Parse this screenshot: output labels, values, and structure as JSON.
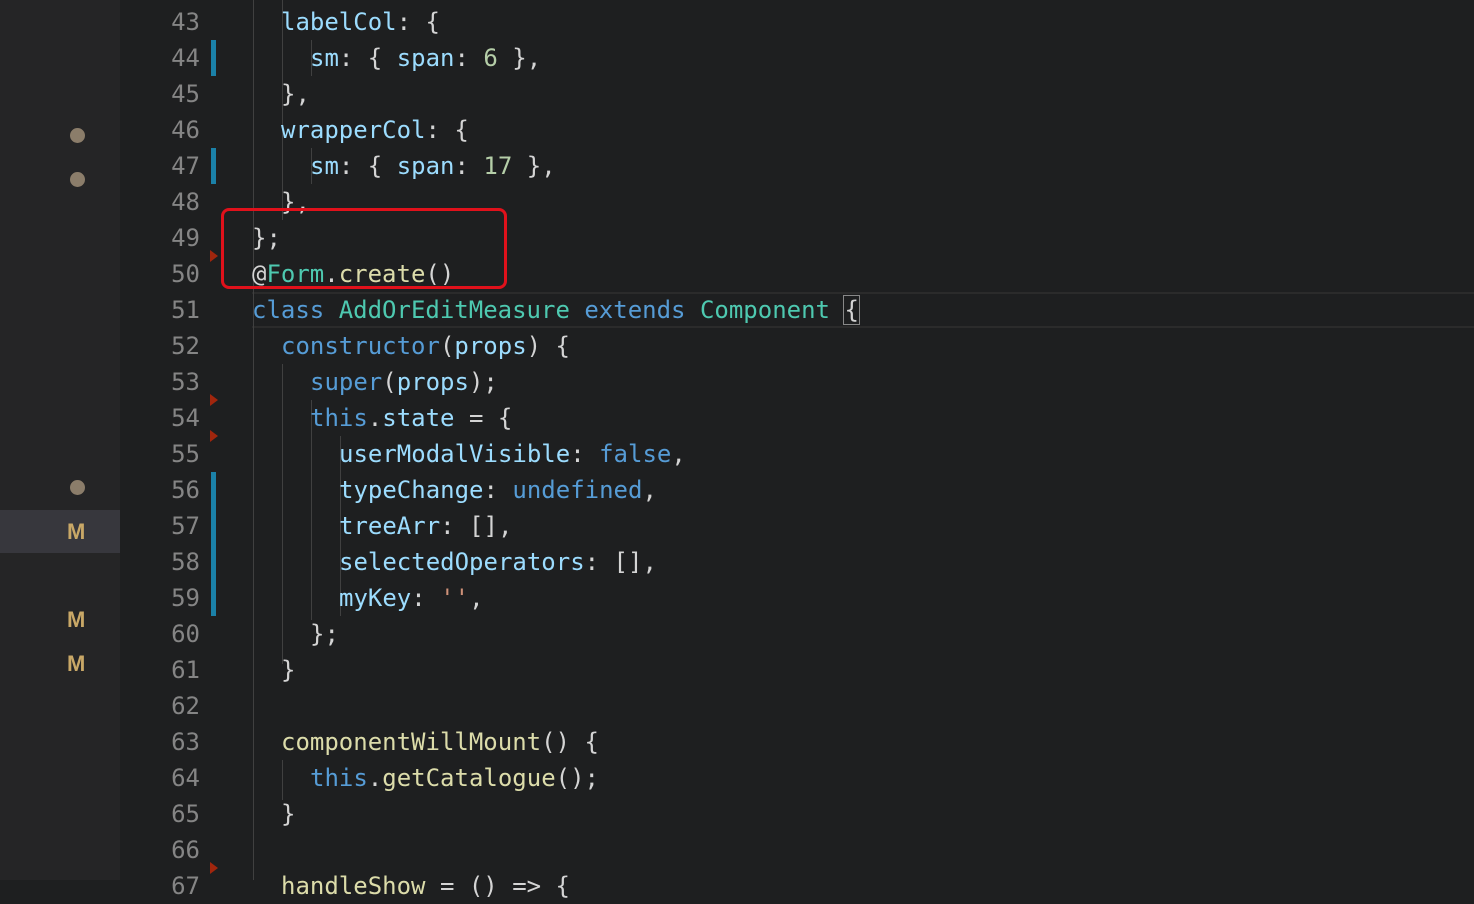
{
  "window": {
    "title": ""
  },
  "sidebar": {
    "badges": [
      {
        "label": "M"
      },
      {
        "label": "M"
      },
      {
        "label": "M"
      }
    ]
  },
  "editor": {
    "colors": {
      "keyword": "#569cd6",
      "property": "#9cdcfe",
      "function": "#dcdcaa",
      "class": "#4ec9b0",
      "number": "#b5cea8",
      "string": "#ce9178",
      "text": "#d4d4d4",
      "highlight_box": "#e0111b",
      "modified_gutter": "#1b81a8"
    },
    "lines": [
      {
        "n": "43",
        "t": [
          {
            "c": "p",
            "v": "labelCol"
          },
          {
            "c": "o",
            "v": ": {"
          }
        ]
      },
      {
        "n": "44",
        "t": [
          {
            "c": "p",
            "v": "sm"
          },
          {
            "c": "o",
            "v": ": { "
          },
          {
            "c": "p",
            "v": "span"
          },
          {
            "c": "o",
            "v": ": "
          },
          {
            "c": "n",
            "v": "6"
          },
          {
            "c": "o",
            "v": " },"
          }
        ]
      },
      {
        "n": "45",
        "t": [
          {
            "c": "o",
            "v": "},"
          }
        ]
      },
      {
        "n": "46",
        "t": [
          {
            "c": "p",
            "v": "wrapperCol"
          },
          {
            "c": "o",
            "v": ": {"
          }
        ]
      },
      {
        "n": "47",
        "t": [
          {
            "c": "p",
            "v": "sm"
          },
          {
            "c": "o",
            "v": ": { "
          },
          {
            "c": "p",
            "v": "span"
          },
          {
            "c": "o",
            "v": ": "
          },
          {
            "c": "n",
            "v": "17"
          },
          {
            "c": "o",
            "v": " },"
          }
        ]
      },
      {
        "n": "48",
        "t": [
          {
            "c": "o",
            "v": "},"
          }
        ]
      },
      {
        "n": "49",
        "t": [
          {
            "c": "o",
            "v": "};"
          }
        ]
      },
      {
        "n": "50",
        "t": [
          {
            "c": "o",
            "v": "@"
          },
          {
            "c": "c",
            "v": "Form"
          },
          {
            "c": "o",
            "v": "."
          },
          {
            "c": "f",
            "v": "create"
          },
          {
            "c": "o",
            "v": "()"
          }
        ]
      },
      {
        "n": "51",
        "t": [
          {
            "c": "k",
            "v": "class"
          },
          {
            "c": "o",
            "v": " "
          },
          {
            "c": "c",
            "v": "AddOrEditMeasure"
          },
          {
            "c": "o",
            "v": " "
          },
          {
            "c": "k",
            "v": "extends"
          },
          {
            "c": "o",
            "v": " "
          },
          {
            "c": "c",
            "v": "Component"
          },
          {
            "c": "o",
            "v": " "
          },
          {
            "c": "b",
            "v": "{"
          }
        ]
      },
      {
        "n": "52",
        "t": [
          {
            "c": "k",
            "v": "constructor"
          },
          {
            "c": "o",
            "v": "("
          },
          {
            "c": "p",
            "v": "props"
          },
          {
            "c": "o",
            "v": ") {"
          }
        ]
      },
      {
        "n": "53",
        "t": [
          {
            "c": "k",
            "v": "super"
          },
          {
            "c": "o",
            "v": "("
          },
          {
            "c": "p",
            "v": "props"
          },
          {
            "c": "o",
            "v": ");"
          }
        ]
      },
      {
        "n": "54",
        "t": [
          {
            "c": "k",
            "v": "this"
          },
          {
            "c": "o",
            "v": "."
          },
          {
            "c": "p",
            "v": "state"
          },
          {
            "c": "o",
            "v": " = {"
          }
        ]
      },
      {
        "n": "55",
        "t": [
          {
            "c": "p",
            "v": "userModalVisible"
          },
          {
            "c": "o",
            "v": ": "
          },
          {
            "c": "k",
            "v": "false"
          },
          {
            "c": "o",
            "v": ","
          }
        ]
      },
      {
        "n": "56",
        "t": [
          {
            "c": "p",
            "v": "typeChange"
          },
          {
            "c": "o",
            "v": ": "
          },
          {
            "c": "k",
            "v": "undefined"
          },
          {
            "c": "o",
            "v": ","
          }
        ]
      },
      {
        "n": "57",
        "t": [
          {
            "c": "p",
            "v": "treeArr"
          },
          {
            "c": "o",
            "v": ": [],"
          }
        ]
      },
      {
        "n": "58",
        "t": [
          {
            "c": "p",
            "v": "selectedOperators"
          },
          {
            "c": "o",
            "v": ": [],"
          }
        ]
      },
      {
        "n": "59",
        "t": [
          {
            "c": "p",
            "v": "myKey"
          },
          {
            "c": "o",
            "v": ": "
          },
          {
            "c": "s",
            "v": "''"
          },
          {
            "c": "o",
            "v": ","
          }
        ]
      },
      {
        "n": "60",
        "t": [
          {
            "c": "o",
            "v": "};"
          }
        ]
      },
      {
        "n": "61",
        "t": [
          {
            "c": "o",
            "v": "}"
          }
        ]
      },
      {
        "n": "62",
        "t": []
      },
      {
        "n": "63",
        "t": [
          {
            "c": "f",
            "v": "componentWillMount"
          },
          {
            "c": "o",
            "v": "() {"
          }
        ]
      },
      {
        "n": "64",
        "t": [
          {
            "c": "k",
            "v": "this"
          },
          {
            "c": "o",
            "v": "."
          },
          {
            "c": "f",
            "v": "getCatalogue"
          },
          {
            "c": "o",
            "v": "();"
          }
        ]
      },
      {
        "n": "65",
        "t": [
          {
            "c": "o",
            "v": "}"
          }
        ]
      },
      {
        "n": "66",
        "t": []
      },
      {
        "n": "67",
        "t": [
          {
            "c": "f",
            "v": "handleShow"
          },
          {
            "c": "o",
            "v": " = () => {"
          }
        ]
      }
    ]
  }
}
